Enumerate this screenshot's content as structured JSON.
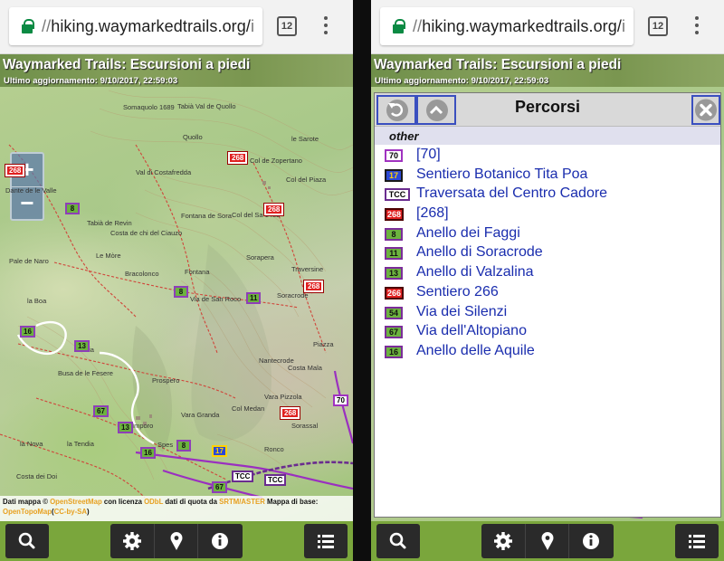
{
  "browser": {
    "url_prefix": "//",
    "url_host": "hiking.waymarkedtrails.org/",
    "url_tail": "i",
    "tab_count": "12"
  },
  "site": {
    "title": "Waymarked Trails: Escursioni a piedi",
    "last_update": "Ultimo aggiornamento: 9/10/2017, 22:59:03"
  },
  "map": {
    "zoom_in": "+",
    "zoom_out": "−",
    "attribution": {
      "t1": "Dati mappa © ",
      "osm": "OpenStreetMap",
      "t2": " con licenza ",
      "odbl": "ODbL",
      "t3": " dati di quota da ",
      "srtm": "SRTM/ASTER",
      "t4": " Mappa di base:",
      "otm": "OpenTopoMap",
      "t5": "(",
      "ccbysa": "CC-by-SA",
      "t6": ")"
    },
    "markers": [
      "268",
      "268",
      "8",
      "268",
      "8",
      "11",
      "16",
      "13",
      "67",
      "13",
      "70",
      "268",
      "8",
      "17",
      "TCC",
      "TCC",
      "16",
      "67",
      "268"
    ],
    "places": [
      "Somaquolo 1689",
      "Tabià Val de Quollo",
      "Quollo",
      "le Sarote",
      "Col de Zopertano",
      "Val di Costafredda",
      "Col del Piaza",
      "Dante de le Valle",
      "Tabià de Revin",
      "Costa de chi del Ciauzo",
      "Pale de Naro",
      "Fontana de Sora",
      "Col del Sa 1482",
      "Le Mòre",
      "Bracolonco",
      "Fontana",
      "Sorapera",
      "Traversine",
      "Via de San Roco",
      "Soracrode",
      "la Boa",
      "Tabia",
      "Busa de le Fesere",
      "Prospero",
      "Piazza",
      "Nantecrode",
      "Costa Mala",
      "Col Medan",
      "Vara Granda",
      "Vara Pizzola",
      "Sorassal",
      "la Tendia",
      "la Nova",
      "Imporo",
      "Spes",
      "Ronco",
      "Costa dei Doi"
    ]
  },
  "panel": {
    "title": "Percorsi",
    "group": "other",
    "routes": [
      {
        "ref": "70",
        "name": "[70]",
        "style": "purple"
      },
      {
        "ref": "17",
        "name": "Sentiero Botanico Tita Poa",
        "style": "blue"
      },
      {
        "ref": "TCC",
        "name": "Traversata del Centro Cadore",
        "style": "tcc"
      },
      {
        "ref": "268",
        "name": "[268]",
        "style": "red"
      },
      {
        "ref": "8",
        "name": "Anello dei Faggi",
        "style": "green"
      },
      {
        "ref": "11",
        "name": "Anello di Soracrode",
        "style": "green"
      },
      {
        "ref": "13",
        "name": "Anello di Valzalina",
        "style": "green"
      },
      {
        "ref": "266",
        "name": "Sentiero 266",
        "style": "red"
      },
      {
        "ref": "54",
        "name": "Via dei Silenzi",
        "style": "green"
      },
      {
        "ref": "67",
        "name": "Via dell'Altopiano",
        "style": "green"
      },
      {
        "ref": "16",
        "name": "Anello delle Aquile",
        "style": "green"
      }
    ]
  },
  "toolbar": [
    "search-icon",
    "gear-icon",
    "map-pin-icon",
    "info-icon",
    "list-icon"
  ],
  "colors": {
    "toolbar_bg": "#7aa63c",
    "route_link": "#1a2dae",
    "route_red": "#e02020",
    "route_purple": "#a033c0"
  }
}
